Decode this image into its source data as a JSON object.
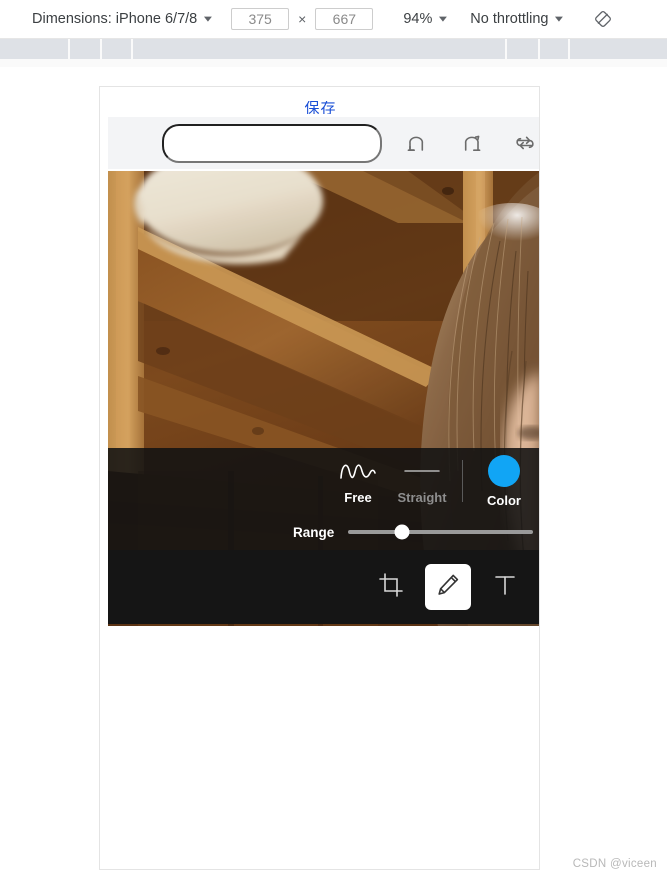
{
  "devtools": {
    "dimensions_label": "Dimensions: iPhone 6/7/8",
    "width_value": "375",
    "height_value": "667",
    "times_symbol": "×",
    "zoom_label": "94%",
    "throttling_label": "No throttling",
    "caret": "▼",
    "rotate_icon": "rotate-device-icon",
    "ruler_ticks": [
      68,
      100,
      131,
      505,
      538,
      568
    ]
  },
  "viewport": {
    "save_label": "保存",
    "search_pill_value": "",
    "search_pill_placeholder": "",
    "history_icons": [
      {
        "name": "undo-icon"
      },
      {
        "name": "redo-icon"
      },
      {
        "name": "reset-icon"
      }
    ],
    "photo": {
      "name": "edited-photo",
      "description": "wooden attic interior with child's head at right"
    },
    "draw_options": {
      "modes": [
        {
          "label": "Free",
          "icon": "wave-line-icon",
          "active": true
        },
        {
          "label": "Straight",
          "icon": "straight-line-icon",
          "active": false
        }
      ],
      "color": {
        "label": "Color",
        "icon": "color-swatch-icon",
        "value": "#11a5f5"
      },
      "range": {
        "label": "Range",
        "value": 29
      }
    },
    "tools": [
      {
        "name": "crop-tool",
        "icon": "crop-icon",
        "active": false
      },
      {
        "name": "draw-tool",
        "icon": "pencil-icon",
        "active": true
      },
      {
        "name": "text-tool",
        "icon": "text-icon",
        "active": false
      }
    ]
  },
  "watermark": "CSDN @viceen"
}
